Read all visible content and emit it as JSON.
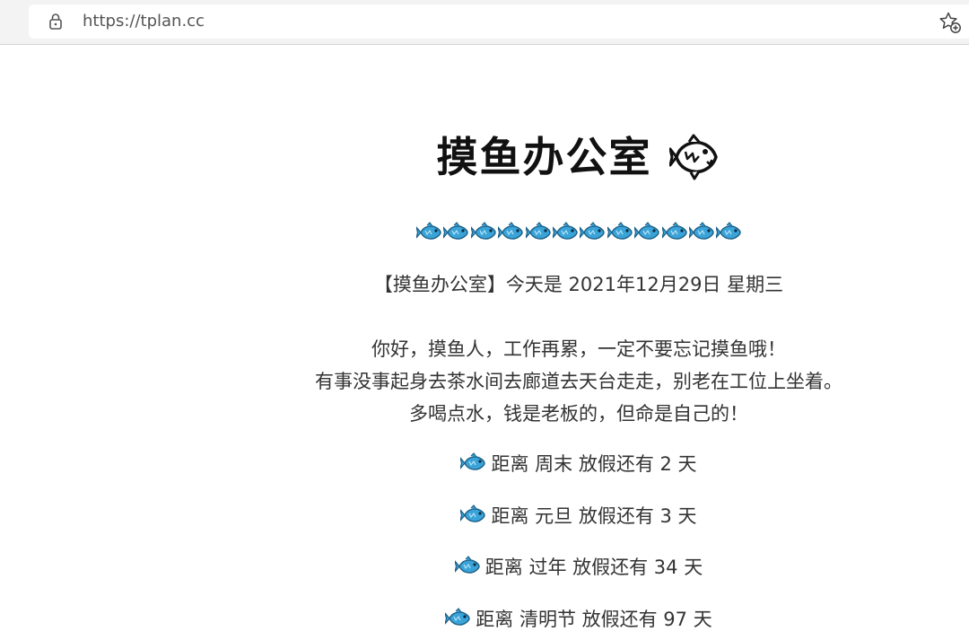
{
  "browser": {
    "url": "https://tplan.cc",
    "back_glyph": ")"
  },
  "page": {
    "title": "摸鱼办公室",
    "date_line": "【摸鱼办公室】今天是 2021年12月29日 星期三",
    "greeting": [
      "你好，摸鱼人，工作再累，一定不要忘记摸鱼哦！",
      "有事没事起身去茶水间去廊道去天台走走，别老在工位上坐着。",
      "多喝点水，钱是老板的，但命是自己的！"
    ],
    "countdowns": [
      "距离 周末 放假还有 2 天",
      "距离 元旦 放假还有 3 天",
      "距离 过年 放假还有 34 天",
      "距离 清明节 放假还有 97 天"
    ],
    "fish_row_count": 12
  },
  "icons": {
    "lock": "lock-icon",
    "favorites": "add-favorite-icon",
    "title_fish": "fish-icon",
    "row_fish": "fish-icon"
  },
  "colors": {
    "fish_body": "#3aa3d8",
    "fish_dark": "#1b5f86",
    "chrome_bg": "#f3f3f3"
  }
}
